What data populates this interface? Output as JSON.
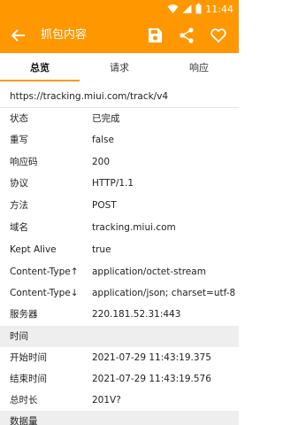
{
  "status_bar": {
    "time": "11:44"
  },
  "app_bar": {
    "title": "抓包内容"
  },
  "tabs": [
    {
      "label": "总览",
      "active": true
    },
    {
      "label": "请求",
      "active": false
    },
    {
      "label": "响应",
      "active": false
    }
  ],
  "url": "https://tracking.miui.com/track/v4",
  "overview": [
    {
      "key": "状态",
      "value": "已完成"
    },
    {
      "key": "重写",
      "value": "false"
    },
    {
      "key": "响应码",
      "value": "200"
    },
    {
      "key": "协议",
      "value": "HTTP/1.1"
    },
    {
      "key": "方法",
      "value": "POST"
    },
    {
      "key": "域名",
      "value": "tracking.miui.com"
    },
    {
      "key": "Kept Alive",
      "value": "true"
    },
    {
      "key": "Content-Type↑",
      "value": "application/octet-stream"
    },
    {
      "key": "Content-Type↓",
      "value": "application/json; charset=utf-8"
    },
    {
      "key": "服务器",
      "value": "220.181.52.31:443"
    }
  ],
  "time_section": {
    "title": "时间",
    "rows": [
      {
        "key": "开始时间",
        "value": "2021-07-29 11:43:19.375"
      },
      {
        "key": "结束时间",
        "value": "2021-07-29 11:43:19.576"
      },
      {
        "key": "总时长",
        "value": "201V?"
      }
    ]
  },
  "data_section": {
    "title": "数据量"
  },
  "colors": {
    "accent": "#ff9800",
    "section_bg": "#eeeeee"
  },
  "icons": [
    "wifi-icon",
    "signal-icon",
    "battery-icon",
    "back-arrow-icon",
    "save-icon",
    "share-icon",
    "heart-icon"
  ]
}
